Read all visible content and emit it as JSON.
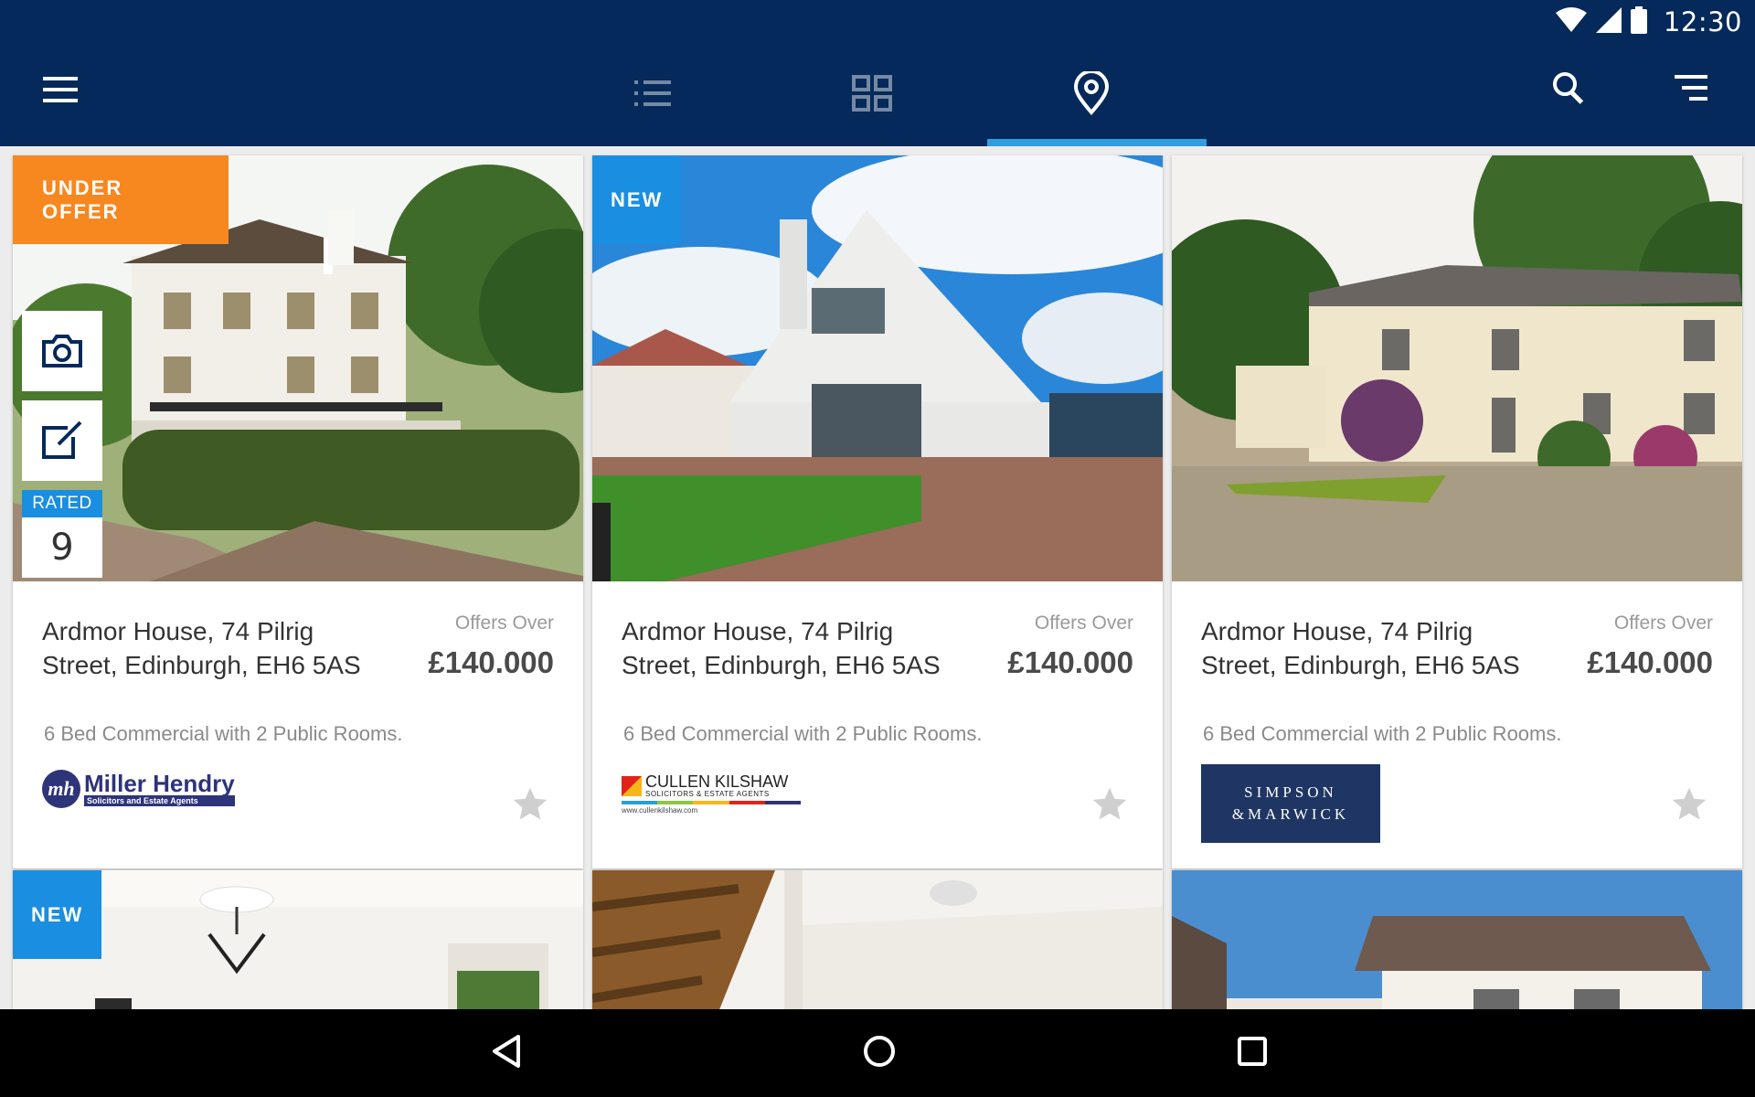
{
  "status_bar": {
    "time": "12:30",
    "icons": [
      "wifi-icon",
      "cellular-signal-icon",
      "battery-icon"
    ]
  },
  "app_bar": {
    "menu_icon": "hamburger-menu-icon",
    "tabs": [
      {
        "icon": "list-view-icon",
        "active": false
      },
      {
        "icon": "grid-view-icon",
        "active": false
      },
      {
        "icon": "map-pin-icon",
        "active": true
      }
    ],
    "actions": [
      "search-icon",
      "filter-sort-icon"
    ],
    "accent_color": "#2f9de0",
    "bar_color": "#04295a"
  },
  "listings": [
    {
      "badge": "UNDER OFFER",
      "badge_color": "#f7871f",
      "rated_label": "RATED",
      "rating": "9",
      "address": "Ardmor House, 74 Pilrig Street, Edinburgh, EH6 5AS",
      "price_label": "Offers Over",
      "price": "£140.000",
      "description": "6 Bed Commercial with 2 Public Rooms.",
      "agent": {
        "name": "Miller Hendry",
        "tagline": "Solicitors and Estate Agents",
        "monogram": "mh"
      }
    },
    {
      "badge": "NEW",
      "badge_color": "#1a8ee0",
      "address": "Ardmor House, 74 Pilrig Street, Edinburgh, EH6 5AS",
      "price_label": "Offers Over",
      "price": "£140.000",
      "description": "6 Bed Commercial with 2 Public Rooms.",
      "agent": {
        "name": "CULLEN KILSHAW",
        "tagline": "SOLICITORS & ESTATE AGENTS",
        "url": "www.cullenkilshaw.com"
      }
    },
    {
      "address": "Ardmor House, 74 Pilrig Street, Edinburgh, EH6 5AS",
      "price_label": "Offers Over",
      "price": "£140.000",
      "description": "6 Bed Commercial with 2 Public Rooms.",
      "agent": {
        "line1": "SIMPSON",
        "line2": "&MARWICK"
      }
    }
  ],
  "partial_listings": [
    {
      "badge": "NEW"
    },
    {},
    {}
  ],
  "nav_bar": [
    "back-icon",
    "home-icon",
    "recents-icon"
  ]
}
